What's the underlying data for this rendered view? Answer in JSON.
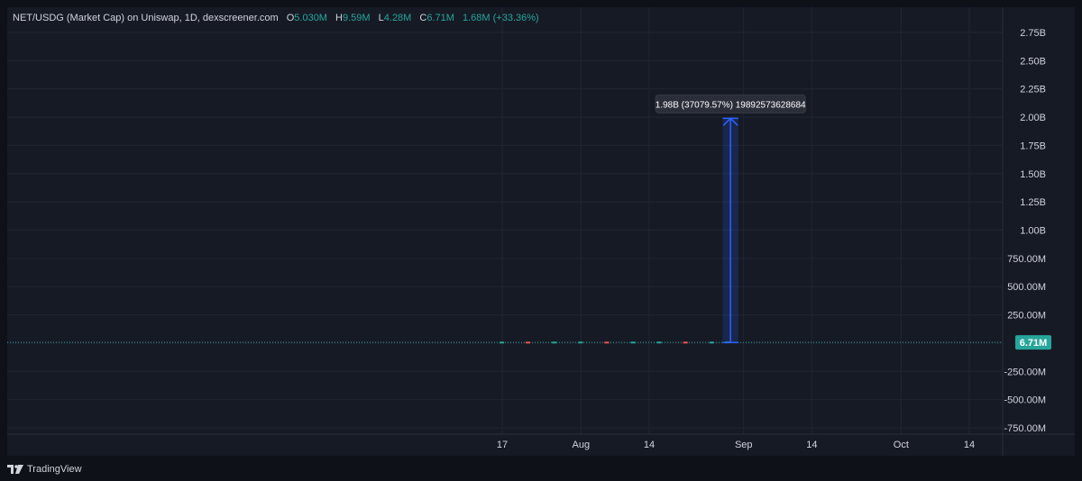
{
  "legend": {
    "symbol": "NET/USDG (Market Cap) on Uniswap, 1D, dexscreener.com",
    "open_label": "O",
    "open": "5.030M",
    "high_label": "H",
    "high": "9.59M",
    "low_label": "L",
    "low": "4.28M",
    "close_label": "C",
    "close": "6.71M",
    "change": "1.68M (+33.36%)"
  },
  "measure_label": "1.98B (37079.57%) 19892573628684",
  "brand": "TradingView",
  "colors": {
    "background": "#161a25",
    "grid": "#222633",
    "up": "#26a69a",
    "down": "#ef5350",
    "measure": "#2962ff",
    "text": "#d1d4dc"
  },
  "chart_data": {
    "type": "line",
    "title": "NET/USDG (Market Cap) on Uniswap, 1D, dexscreener.com",
    "ylim": [
      -800000000,
      2850000000
    ],
    "y_ticks": [
      2750000000,
      2500000000,
      2250000000,
      2000000000,
      1750000000,
      1500000000,
      1250000000,
      1000000000,
      750000000,
      500000000,
      250000000,
      0,
      -250000000,
      -500000000,
      -750000000
    ],
    "y_tick_labels": [
      "2.75B",
      "2.50B",
      "2.25B",
      "2.00B",
      "1.75B",
      "1.50B",
      "1.25B",
      "1.00B",
      "750.00M",
      "500.00M",
      "250.00M",
      "0.00",
      "-250.00M",
      "-500.00M",
      "-750.00M"
    ],
    "x_range": [
      "2025-07-05",
      "2025-11-05"
    ],
    "x_ticks": [
      "2025-07-17",
      "2025-08-01",
      "2025-08-14",
      "2025-09-01",
      "2025-09-14",
      "2025-10-01",
      "2025-10-14"
    ],
    "x_tick_labels": [
      "17",
      "Aug",
      "14",
      "Sep",
      "14",
      "Oct",
      "14"
    ],
    "series": [
      {
        "x": [
          "2025-07-17",
          "2025-07-22",
          "2025-07-27",
          "2025-08-01",
          "2025-08-06",
          "2025-08-11",
          "2025-08-16",
          "2025-08-21",
          "2025-08-26",
          "2025-08-29"
        ],
        "values": [
          5000000,
          4800000,
          5200000,
          5500000,
          4900000,
          5100000,
          5300000,
          5000000,
          5030000,
          6710000
        ]
      }
    ],
    "last_price": 6710000,
    "last_price_label": "6.71M",
    "measurement": {
      "x_start": "2025-08-28",
      "x_end": "2025-08-31",
      "y_start": 5030000,
      "y_end": 1990000000,
      "label": "1.98B (37079.57%) 19892573628684"
    },
    "grid": true
  }
}
